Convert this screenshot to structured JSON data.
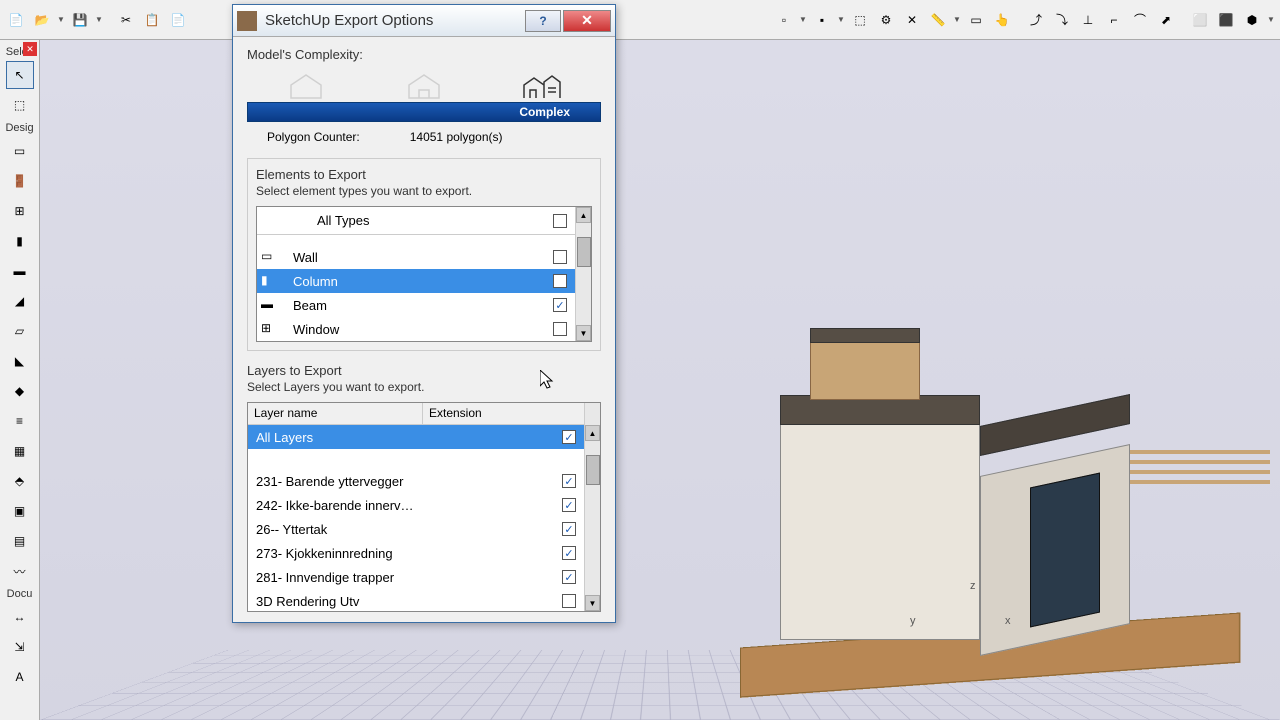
{
  "dialog": {
    "title": "SketchUp Export Options",
    "complexity_label": "Model's Complexity:",
    "complexity_value": "Complex",
    "polygon_label": "Polygon Counter:",
    "polygon_value": "14051",
    "polygon_unit": "polygon(s)",
    "elements": {
      "title": "Elements to Export",
      "subtitle": "Select element types you want to export.",
      "all_types": "All Types",
      "items": [
        {
          "label": "Wall",
          "checked": false
        },
        {
          "label": "Column",
          "checked": false,
          "selected": true
        },
        {
          "label": "Beam",
          "checked": true
        },
        {
          "label": "Window",
          "checked": false
        }
      ]
    },
    "layers": {
      "title": "Layers to Export",
      "subtitle": "Select Layers you want to export.",
      "col1": "Layer name",
      "col2": "Extension",
      "all_layers": "All Layers",
      "items": [
        {
          "label": "231- Barende yttervegger",
          "checked": true
        },
        {
          "label": "242- Ikke-barende innerv…",
          "checked": true
        },
        {
          "label": "26-- Yttertak",
          "checked": true
        },
        {
          "label": "273- Kjokkeninnredning",
          "checked": true
        },
        {
          "label": "281- Innvendige trapper",
          "checked": true
        },
        {
          "label": "3D Rendering Utv",
          "checked": false
        }
      ]
    }
  },
  "left_panel": {
    "tab1": "Selec",
    "tab2": "Desig",
    "tab3": "Docu"
  },
  "axes": {
    "x": "x",
    "y": "y",
    "z": "z"
  }
}
